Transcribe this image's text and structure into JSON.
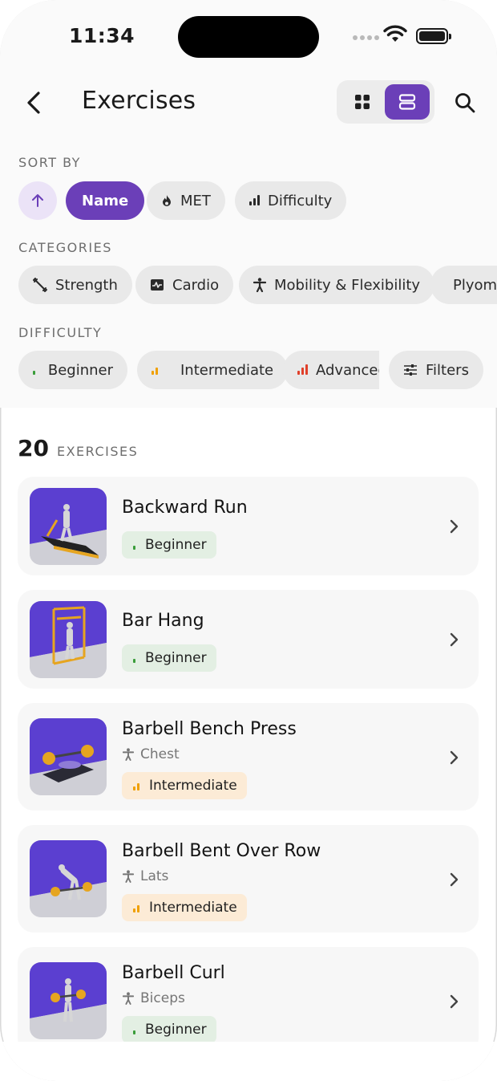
{
  "status": {
    "time": "11:34"
  },
  "header": {
    "title": "Exercises"
  },
  "sort": {
    "label": "SORT BY",
    "options": [
      {
        "label": "Name",
        "icon": "sort-name"
      },
      {
        "label": "MET",
        "icon": "flame-icon"
      },
      {
        "label": "Difficulty",
        "icon": "bars-icon"
      }
    ],
    "active": "Name"
  },
  "categories": {
    "label": "CATEGORIES",
    "items": [
      {
        "label": "Strength",
        "icon": "dumbbell-icon"
      },
      {
        "label": "Cardio",
        "icon": "pulse-icon"
      },
      {
        "label": "Mobility & Flexibility",
        "icon": "person-icon"
      },
      {
        "label": "Plyometrics",
        "icon": "bolt-icon"
      }
    ]
  },
  "difficulty": {
    "label": "DIFFICULTY",
    "items": [
      {
        "label": "Beginner",
        "level": 1
      },
      {
        "label": "Intermediate",
        "level": 2
      },
      {
        "label": "Advanced",
        "level": 3
      }
    ],
    "filters_label": "Filters"
  },
  "results": {
    "count": "20",
    "label": "EXERCISES"
  },
  "exercises": [
    {
      "name": "Backward Run",
      "muscle": "",
      "difficulty": "Beginner"
    },
    {
      "name": "Bar Hang",
      "muscle": "",
      "difficulty": "Beginner"
    },
    {
      "name": "Barbell Bench Press",
      "muscle": "Chest",
      "difficulty": "Intermediate"
    },
    {
      "name": "Barbell Bent Over Row",
      "muscle": "Lats",
      "difficulty": "Intermediate"
    },
    {
      "name": "Barbell Curl",
      "muscle": "Biceps",
      "difficulty": "Beginner"
    }
  ],
  "colors": {
    "accent": "#6b3fb8",
    "beginner": "#3a9d3a",
    "intermediate": "#f0a000",
    "advanced": "#e0402a"
  }
}
